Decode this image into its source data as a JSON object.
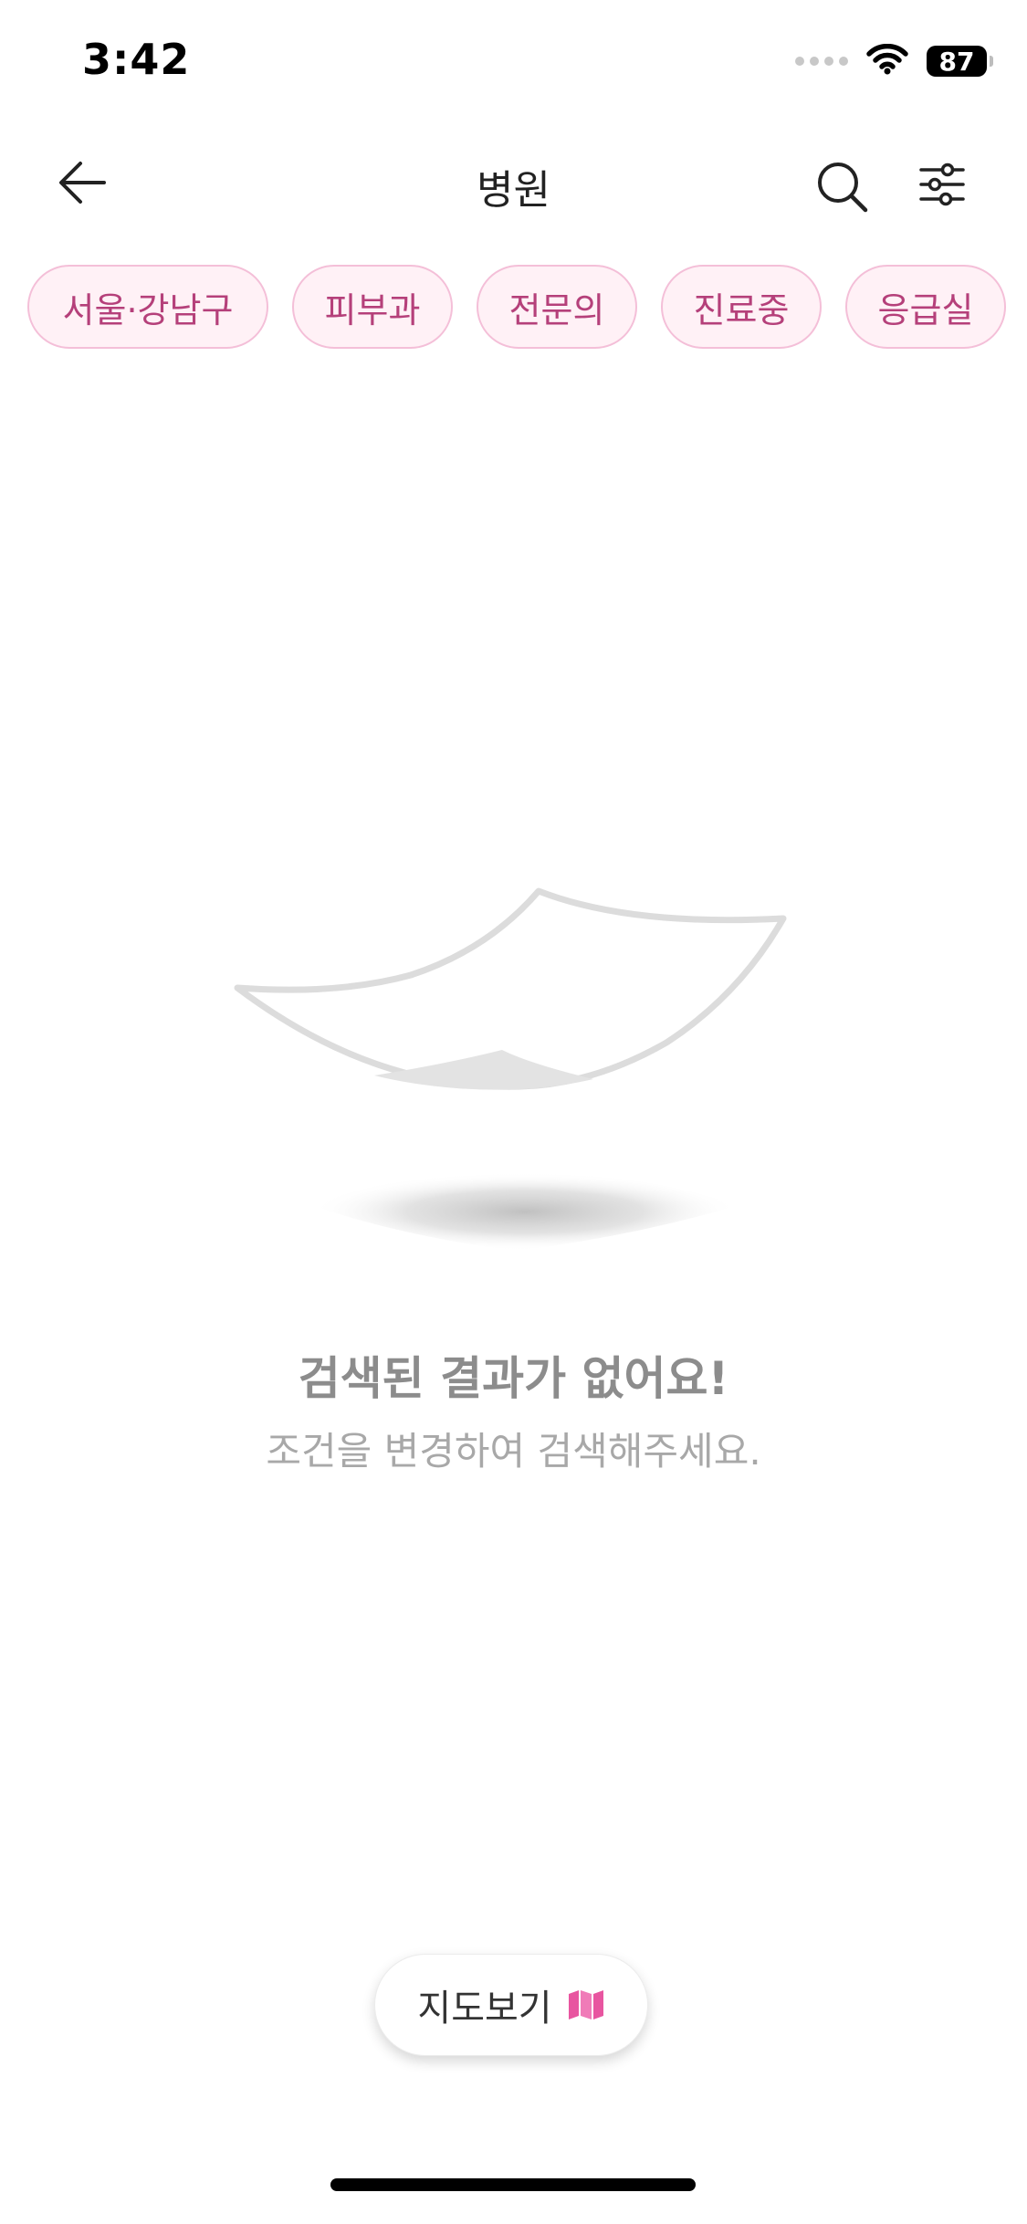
{
  "status_bar": {
    "time": "3:42",
    "battery": "87",
    "icons": [
      "signal-dots-icon",
      "wifi-icon",
      "battery-icon"
    ]
  },
  "nav": {
    "title": "병원",
    "icons": [
      "back-arrow-icon",
      "search-icon",
      "filter-sliders-icon"
    ]
  },
  "chips": [
    {
      "label": "서울·강남구"
    },
    {
      "label": "피부과"
    },
    {
      "label": "전문의"
    },
    {
      "label": "진료중"
    },
    {
      "label": "응급실"
    }
  ],
  "empty_state": {
    "title": "검색된 결과가 없어요!",
    "subtitle": "조건을 변경하여 검색해주세요.",
    "illustration": "floating-paper-illustration"
  },
  "map_button": {
    "label": "지도보기",
    "icon": "map-icon"
  },
  "colors": {
    "chip_text": "#b5407a",
    "chip_bg": "#fff1f6",
    "chip_border": "#f4bfd8",
    "accent": "#e855a0",
    "empty_text": "#8c8c8c"
  }
}
